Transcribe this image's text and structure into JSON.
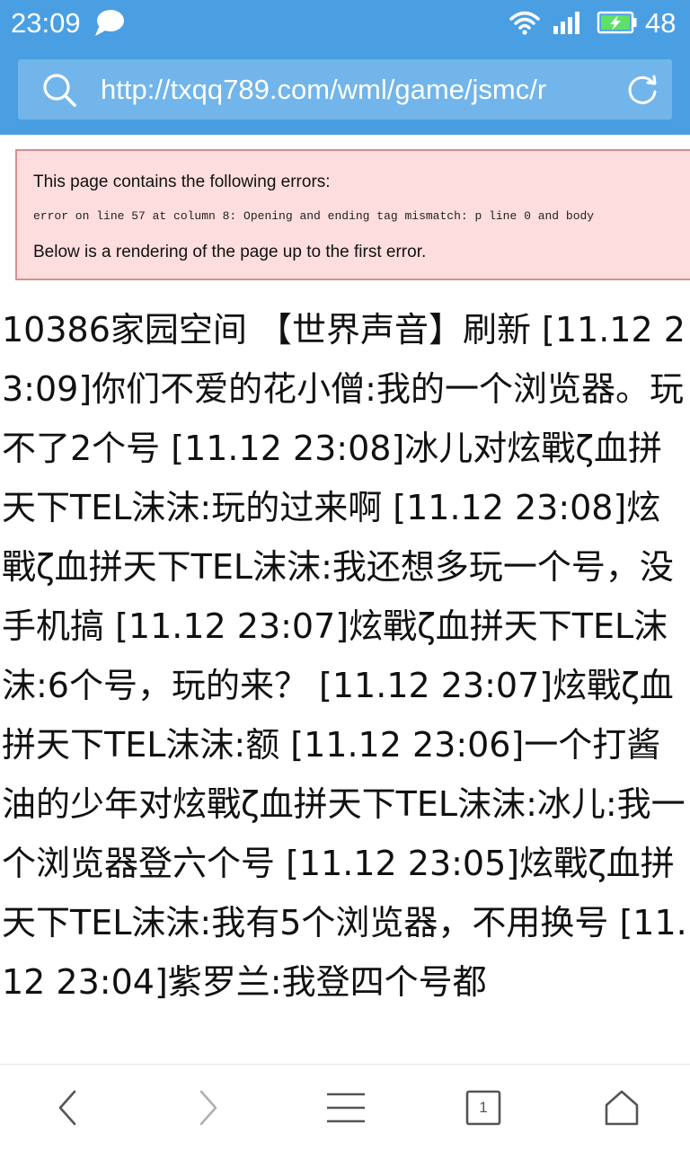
{
  "status_bar": {
    "time": "23:09",
    "battery_level": "48",
    "icons": [
      "chat-bubble-icon",
      "wifi-icon",
      "signal-icon",
      "battery-charging-icon"
    ]
  },
  "address_bar": {
    "url": "http://txqq789.com/wml/game/jsmc/r",
    "icons": [
      "search-icon",
      "reload-icon"
    ]
  },
  "error_box": {
    "title": "This page contains the following errors:",
    "detail": "error on line 57 at column 8: Opening and ending tag mismatch: p line 0 and body",
    "footer": "Below is a rendering of the page up to the first error."
  },
  "content": {
    "text": "10386家园空间 【世界声音】刷新 [11.12 23:09]你们不爱的花小僧:我的一个浏览器。玩不了2个号 [11.12 23:08]冰儿对炫戰ζ血拼天下TEL沫沫:玩的过来啊 [11.12 23:08]炫戰ζ血拼天下TEL沫沫:我还想多玩一个号，没手机搞 [11.12 23:07]炫戰ζ血拼天下TEL沫沫:6个号，玩的来？ [11.12 23:07]炫戰ζ血拼天下TEL沫沫:额 [11.12 23:06]一个打酱油的少年对炫戰ζ血拼天下TEL沫沫:冰儿:我一个浏览器登六个号 [11.12 23:05]炫戰ζ血拼天下TEL沫沫:我有5个浏览器，不用换号 [11.12 23:04]紫罗兰:我登四个号都"
  },
  "toolbar": {
    "tab_count": "1",
    "icons": [
      "back-icon",
      "forward-icon",
      "menu-icon",
      "tabs-icon",
      "home-icon"
    ]
  },
  "colors": {
    "header_blue": "#4a9fe3",
    "address_bar_blue": "#72b5ea",
    "error_background": "#fddddd",
    "error_border": "#d49090"
  }
}
